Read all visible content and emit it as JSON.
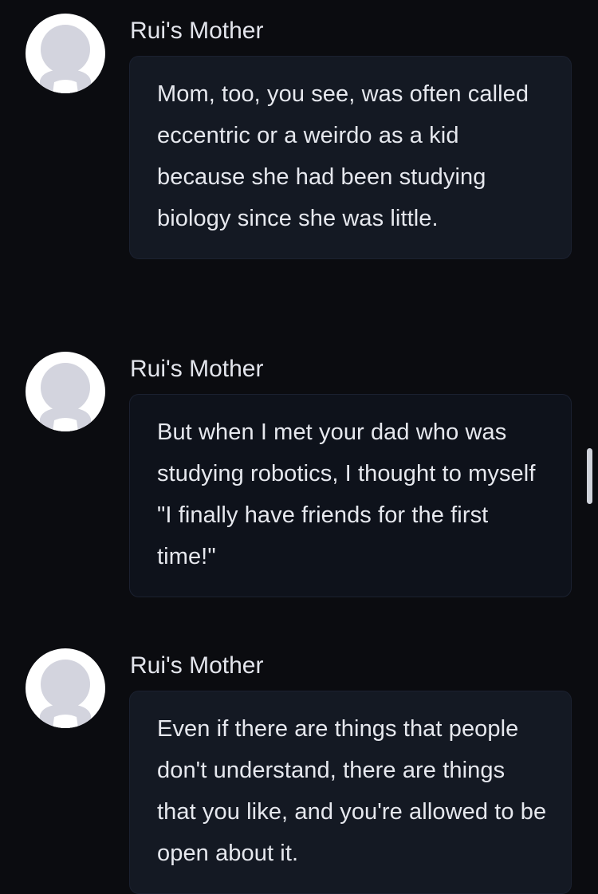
{
  "conversation": {
    "messages": [
      {
        "sender": "Rui's Mother",
        "text": "Mom, too, you see, was often called eccentric or a weirdo as a kid because she had been studying biology since she was little."
      },
      {
        "sender": "Rui's Mother",
        "text": "But when I met your dad who was studying robotics, I thought to myself \"I finally have friends for the first time!\""
      },
      {
        "sender": "Rui's Mother",
        "text": "Even if there are things that people don't understand, there are things that you like, and you're allowed to be open about it."
      }
    ]
  },
  "avatar_icon": "default-user-avatar-icon",
  "colors": {
    "background": "#0b0c10",
    "bubble": "#141923",
    "text": "#e6e8ee",
    "avatar_bg": "#ffffff",
    "avatar_silhouette": "#d3d4de"
  }
}
